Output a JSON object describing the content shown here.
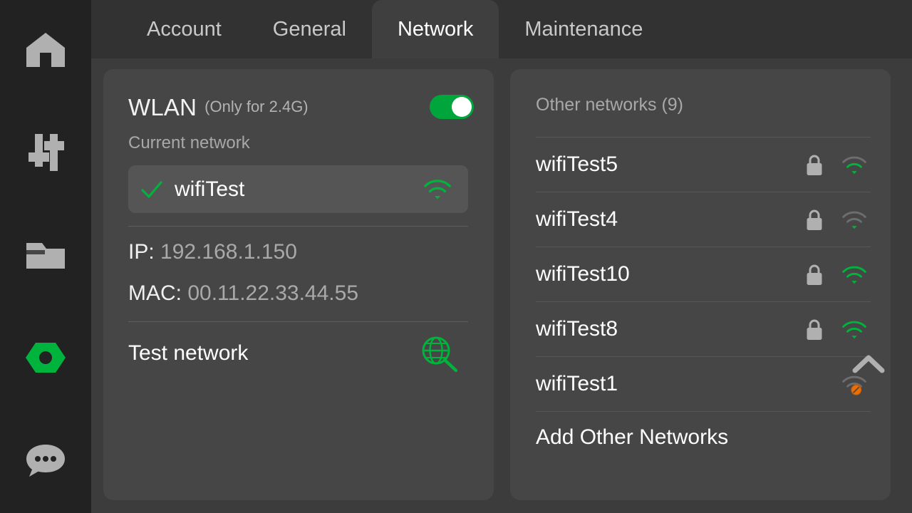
{
  "colors": {
    "accent_green": "#00b33c",
    "toggle_on": "#00a63c",
    "sidebar_bg": "#222222",
    "panel_bg": "#464646",
    "content_bg": "#3c3c3c",
    "tabstrip_bg": "#323232",
    "active_tab_bg": "#3f3f3f",
    "icon_gray": "#b0b0b0",
    "blocked_orange": "#e8700a",
    "text_primary": "#ffffff",
    "text_muted": "#a8a8a8"
  },
  "sidebar": {
    "items": [
      {
        "name": "home-icon",
        "label": "Home"
      },
      {
        "name": "sliders-icon",
        "label": "Settings"
      },
      {
        "name": "folder-icon",
        "label": "Files"
      },
      {
        "name": "hex-nut-icon",
        "label": "Device",
        "active": true
      },
      {
        "name": "chat-bubble-icon",
        "label": "Messages"
      }
    ]
  },
  "tabs": [
    {
      "label": "Account",
      "active": false
    },
    {
      "label": "General",
      "active": false
    },
    {
      "label": "Network",
      "active": true
    },
    {
      "label": "Maintenance",
      "active": false
    }
  ],
  "wlan": {
    "title": "WLAN",
    "subtitle": "(Only for 2.4G)",
    "toggle_on": true,
    "current_network_label": "Current network",
    "current_network": {
      "ssid": "wifiTest",
      "connected": true,
      "signal_bars": 3
    },
    "ip_key": "IP:",
    "ip_value": "192.168.1.150",
    "mac_key": "MAC:",
    "mac_value": "00.11.22.33.44.55",
    "test_network_label": "Test network",
    "test_network_icon": "globe-magnifier-icon"
  },
  "other_networks": {
    "header": "Other networks (9)",
    "count": 9,
    "rows": [
      {
        "ssid": "wifiTest5",
        "locked": true,
        "signal_bars": 2,
        "blocked": false
      },
      {
        "ssid": "wifiTest4",
        "locked": true,
        "signal_bars": 1,
        "blocked": false
      },
      {
        "ssid": "wifiTest10",
        "locked": true,
        "signal_bars": 3,
        "blocked": false
      },
      {
        "ssid": "wifiTest8",
        "locked": true,
        "signal_bars": 3,
        "blocked": false
      },
      {
        "ssid": "wifiTest1",
        "locked": false,
        "signal_bars": 0,
        "blocked": true
      }
    ],
    "add_label": "Add Other Networks"
  }
}
